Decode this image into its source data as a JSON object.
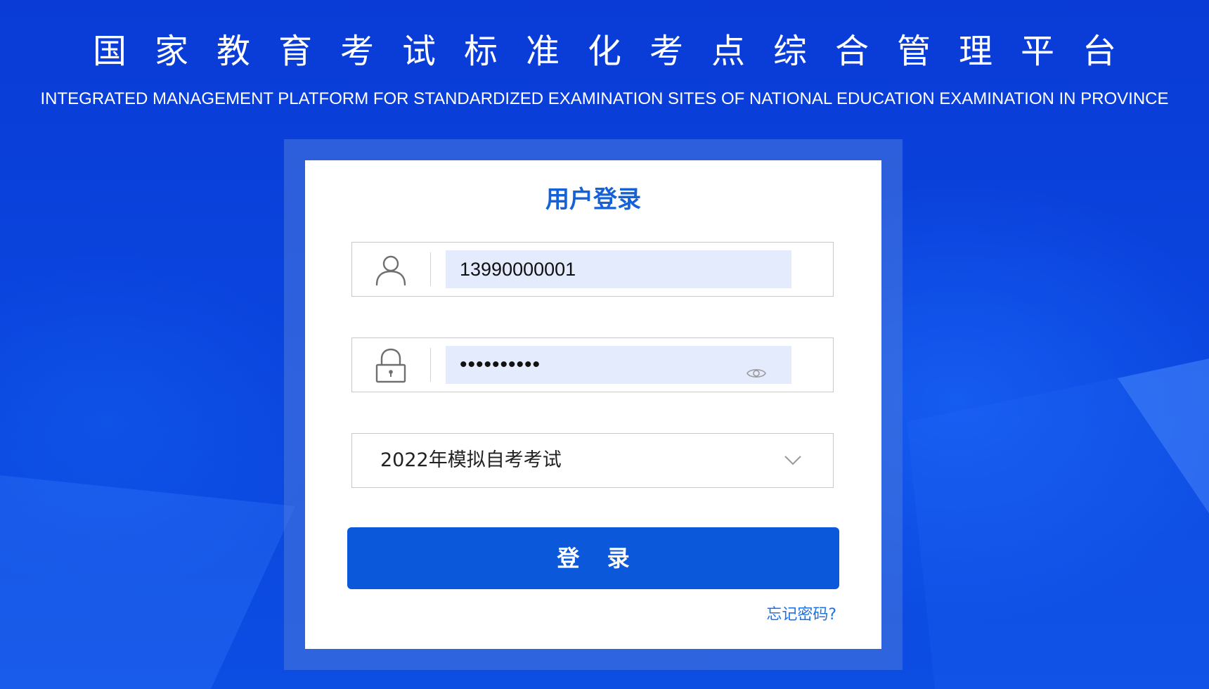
{
  "header": {
    "title_cn": "国家教育考试标准化考点综合管理平台",
    "title_en": "INTEGRATED MANAGEMENT PLATFORM FOR STANDARDIZED EXAMINATION SITES OF NATIONAL EDUCATION EXAMINATION IN PROVINCE"
  },
  "login": {
    "title": "用户登录",
    "username": {
      "icon": "user-icon",
      "value": "13990000001"
    },
    "password": {
      "icon": "lock-icon",
      "masked_value": "••••••••••",
      "toggle_icon": "eye-icon"
    },
    "exam_select": {
      "selected": "2022年模拟自考考试",
      "icon": "chevron-down-icon"
    },
    "submit_label": "登 录",
    "forgot_label": "忘记密码?"
  },
  "colors": {
    "background": "#0a43dd",
    "title_blue": "#1562d8",
    "button_blue": "#0b59da",
    "link_blue": "#1f72e6",
    "input_fill": "#e3ebfd"
  }
}
